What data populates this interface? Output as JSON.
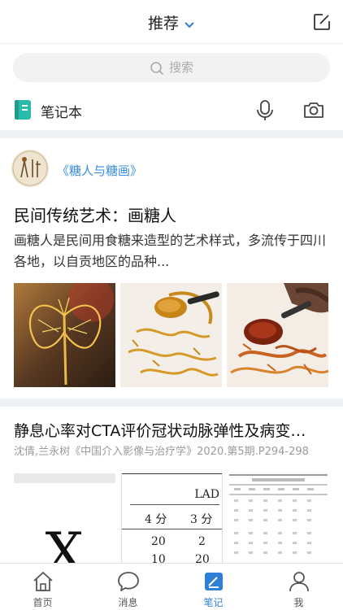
{
  "header": {
    "title": "推荐"
  },
  "search": {
    "placeholder": "搜索"
  },
  "notebook": {
    "label": "笔记本"
  },
  "feed": [
    {
      "book_title": "《糖人与糖画》",
      "title": "民间传统艺术：画糖人",
      "snippet": "画糖人是民间用食糖来造型的艺术样式，多流传于四川各地，以自贡地区的品种..."
    },
    {
      "title": "静息心率对CTA评价冠状动脉弹性及病变…",
      "meta": "沈倩,兰永树《中国介入影像与治疗学》2020.第5期.P294-298",
      "table_preview": {
        "header": "LAD",
        "columns": [
          "4 分",
          "3 分"
        ],
        "rows": [
          [
            "20",
            "2"
          ],
          [
            "10",
            "20"
          ]
        ]
      },
      "figure_letter": "X"
    }
  ],
  "tabs": [
    {
      "label": "首页",
      "icon": "home-icon",
      "active": false
    },
    {
      "label": "消息",
      "icon": "message-icon",
      "active": false
    },
    {
      "label": "笔记",
      "icon": "note-icon",
      "active": true
    },
    {
      "label": "我",
      "icon": "profile-icon",
      "active": false
    }
  ],
  "colors": {
    "accent": "#2f7fd6",
    "link": "#3a8ee6",
    "notebook_icon": "#2bbbaa",
    "divider": "#eef1f4"
  }
}
